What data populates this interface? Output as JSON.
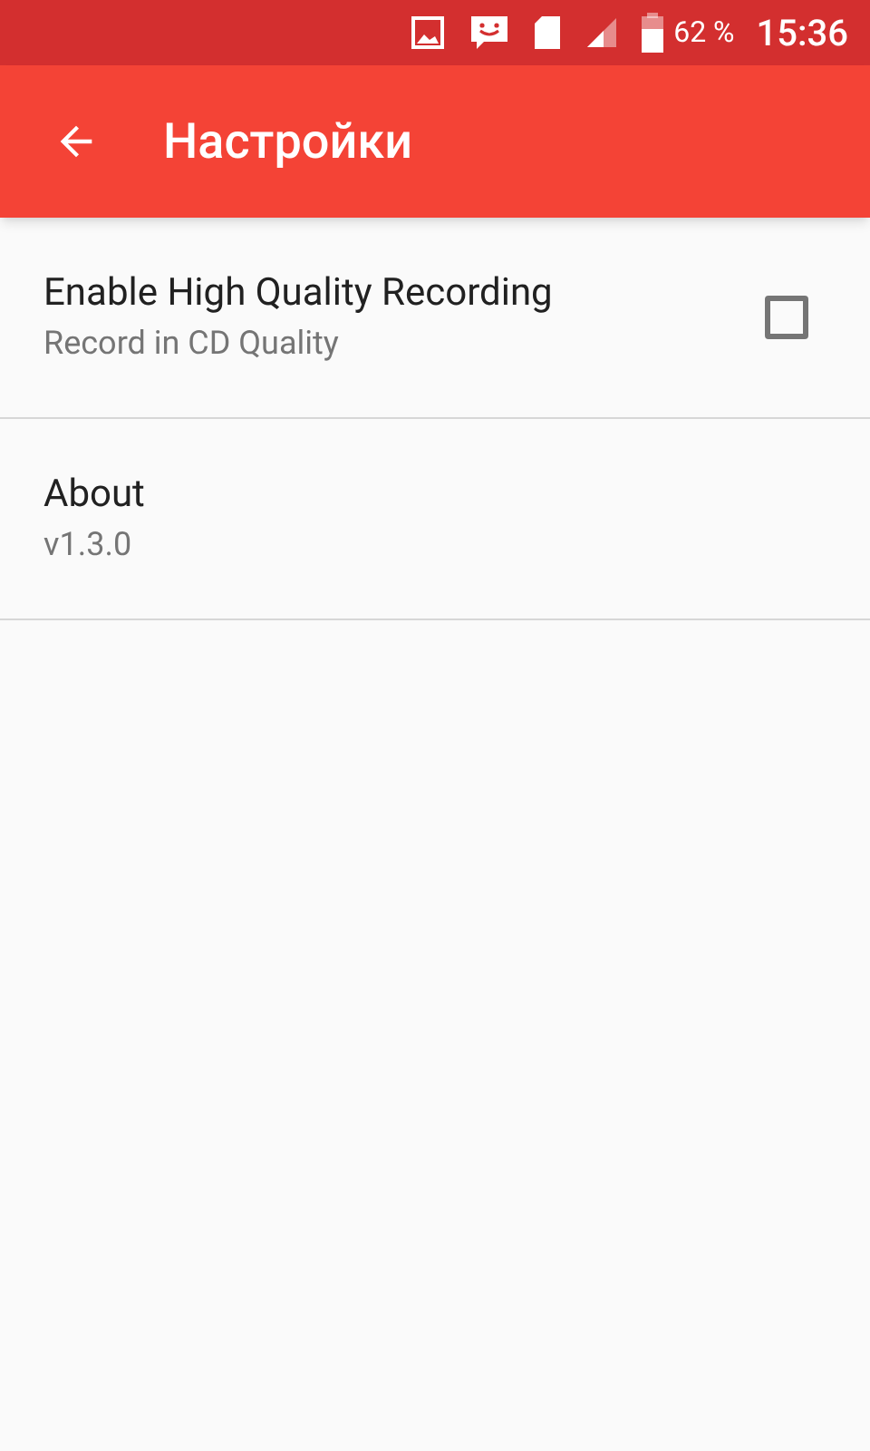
{
  "status_bar": {
    "battery": "62 %",
    "time": "15:36"
  },
  "app_bar": {
    "title": "Настройки"
  },
  "settings": [
    {
      "kind": "checkbox",
      "title": "Enable High Quality Recording",
      "summary": "Record in CD Quality",
      "checked": false
    },
    {
      "kind": "plain",
      "title": "About",
      "summary": "v1.3.0"
    }
  ]
}
